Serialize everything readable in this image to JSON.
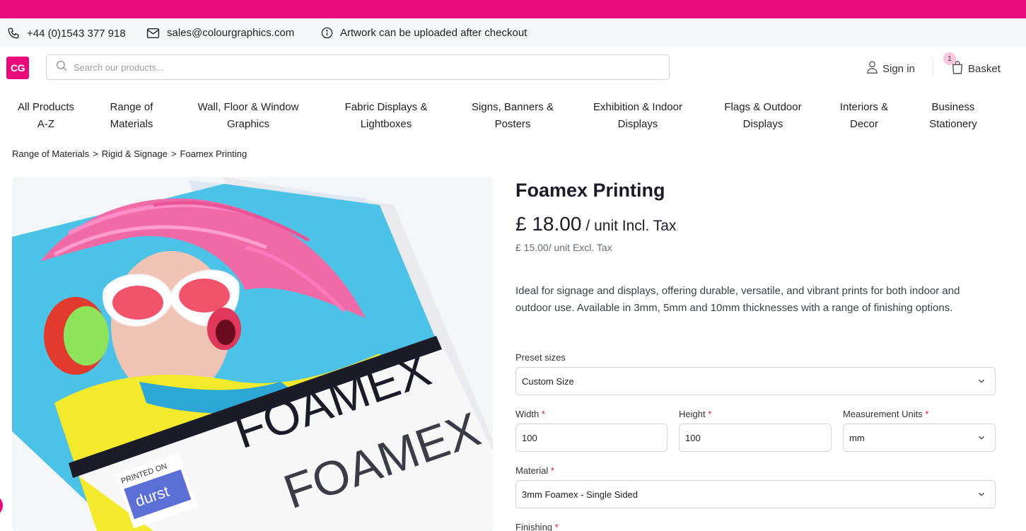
{
  "contact": {
    "phone": "+44 (0)1543 377 918",
    "email": "sales@colourgraphics.com",
    "notice": "Artwork can be uploaded after checkout"
  },
  "header": {
    "logo_text": "CG",
    "search_placeholder": "Search our products...",
    "sign_in": "Sign in",
    "basket_label": "Basket",
    "basket_count": "1"
  },
  "nav": {
    "items": [
      {
        "label": "All Products\nA-Z"
      },
      {
        "label": "Range of\nMaterials"
      },
      {
        "label": "Wall, Floor & Window\nGraphics"
      },
      {
        "label": "Fabric Displays &\nLightboxes"
      },
      {
        "label": "Signs, Banners &\nPosters"
      },
      {
        "label": "Exhibition & Indoor\nDisplays"
      },
      {
        "label": "Flags & Outdoor\nDisplays"
      },
      {
        "label": "Interiors &\nDecor"
      },
      {
        "label": "Business\nStationery"
      }
    ]
  },
  "breadcrumb": {
    "items": [
      "Range of Materials",
      "Rigid & Signage",
      "Foamex Printing"
    ],
    "separator": ">"
  },
  "product": {
    "title": "Foamex Printing",
    "price_incl": "£ 18.00",
    "price_incl_suffix": "/ unit Incl. Tax",
    "price_excl": "£ 15.00/ unit Excl. Tax",
    "description": "Ideal for signage and displays, offering durable, versatile, and vibrant prints for both indoor and outdoor use. Available in 3mm, 5mm and 10mm thicknesses with a range of finishing options.",
    "image_text": {
      "headline": "FOAMEX",
      "badge_top": "PRINTED ON",
      "badge_brand": "durst"
    }
  },
  "form": {
    "preset_sizes": {
      "label": "Preset sizes",
      "value": "Custom Size"
    },
    "width": {
      "label": "Width",
      "value": "100"
    },
    "height": {
      "label": "Height",
      "value": "100"
    },
    "units": {
      "label": "Measurement Units",
      "value": "mm"
    },
    "material": {
      "label": "Material",
      "value": "3mm Foamex - Single Sided"
    },
    "finishing": {
      "label": "Finishing"
    },
    "required_mark": "*"
  },
  "colors": {
    "brand": "#e8097a",
    "required": "#d6123a"
  }
}
